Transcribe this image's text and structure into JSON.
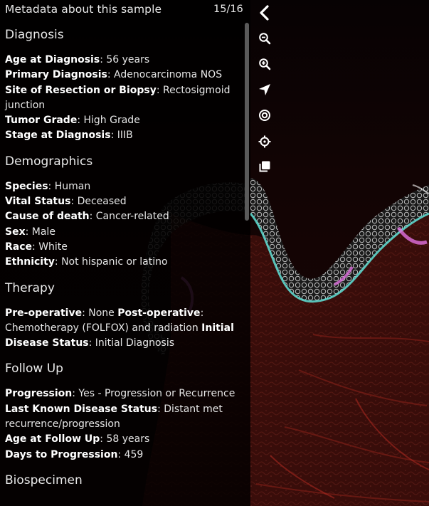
{
  "panel": {
    "title": "Metadata about this sample",
    "counter": "15/16"
  },
  "sections": [
    {
      "title": "Diagnosis",
      "rows": [
        [
          {
            "t": "Age at Diagnosis",
            "b": true
          },
          {
            "t": ": 56 years"
          }
        ],
        [
          {
            "t": "Primary Diagnosis",
            "b": true
          },
          {
            "t": ": Adenocarcinoma NOS"
          }
        ],
        [
          {
            "t": "Site of Resection or Biopsy",
            "b": true
          },
          {
            "t": ": Rectosigmoid"
          }
        ],
        [
          {
            "t": "junction"
          }
        ],
        [
          {
            "t": "Tumor Grade",
            "b": true
          },
          {
            "t": ": High Grade"
          }
        ],
        [
          {
            "t": "Stage at Diagnosis",
            "b": true
          },
          {
            "t": ": IIIB"
          }
        ]
      ]
    },
    {
      "title": "Demographics",
      "rows": [
        [
          {
            "t": "Species",
            "b": true
          },
          {
            "t": ": Human"
          }
        ],
        [
          {
            "t": "Vital Status",
            "b": true
          },
          {
            "t": ": Deceased"
          }
        ],
        [
          {
            "t": "Cause of death",
            "b": true
          },
          {
            "t": ": Cancer-related"
          }
        ],
        [
          {
            "t": "Sex",
            "b": true
          },
          {
            "t": ": Male"
          }
        ],
        [
          {
            "t": "Race",
            "b": true
          },
          {
            "t": ": White"
          }
        ],
        [
          {
            "t": "Ethnicity",
            "b": true
          },
          {
            "t": ": Not hispanic or latino"
          }
        ]
      ]
    },
    {
      "title": "Therapy",
      "rows": [
        [
          {
            "t": "Pre-operative",
            "b": true
          },
          {
            "t": ": None "
          },
          {
            "t": "Post-operative",
            "b": true
          },
          {
            "t": ":"
          }
        ],
        [
          {
            "t": "Chemotherapy (FOLFOX) and radiation "
          },
          {
            "t": "Initial",
            "b": true
          }
        ],
        [
          {
            "t": "Disease Status",
            "b": true
          },
          {
            "t": ": Initial Diagnosis"
          }
        ]
      ]
    },
    {
      "title": "Follow Up",
      "rows": [
        [
          {
            "t": "Progression",
            "b": true
          },
          {
            "t": ": Yes - Progression or Recurrence"
          }
        ],
        [
          {
            "t": "Last Known Disease Status",
            "b": true
          },
          {
            "t": ": Distant met"
          }
        ],
        [
          {
            "t": "recurrence/progression"
          }
        ],
        [
          {
            "t": "Age at Follow Up",
            "b": true
          },
          {
            "t": ": 58 years"
          }
        ],
        [
          {
            "t": "Days to Progression",
            "b": true
          },
          {
            "t": ": 459"
          }
        ]
      ]
    },
    {
      "title": "Biospecimen",
      "rows": []
    }
  ],
  "toolbar": [
    {
      "name": "back-chevron-icon",
      "icon": "chevron-left"
    },
    {
      "name": "zoom-out-icon",
      "icon": "zoom-out"
    },
    {
      "name": "zoom-in-icon",
      "icon": "zoom-in"
    },
    {
      "name": "location-arrow-icon",
      "icon": "location-arrow"
    },
    {
      "name": "target-icon",
      "icon": "target"
    },
    {
      "name": "crosshair-icon",
      "icon": "crosshair"
    },
    {
      "name": "copy-icon",
      "icon": "copy"
    }
  ],
  "colors": {
    "tissue_red": "#5a1410",
    "tissue_edge_cyan": "#5fe0d6",
    "tissue_edge_magenta": "#e070e0",
    "panel_bg": "rgba(0,0,0,0.80)"
  }
}
